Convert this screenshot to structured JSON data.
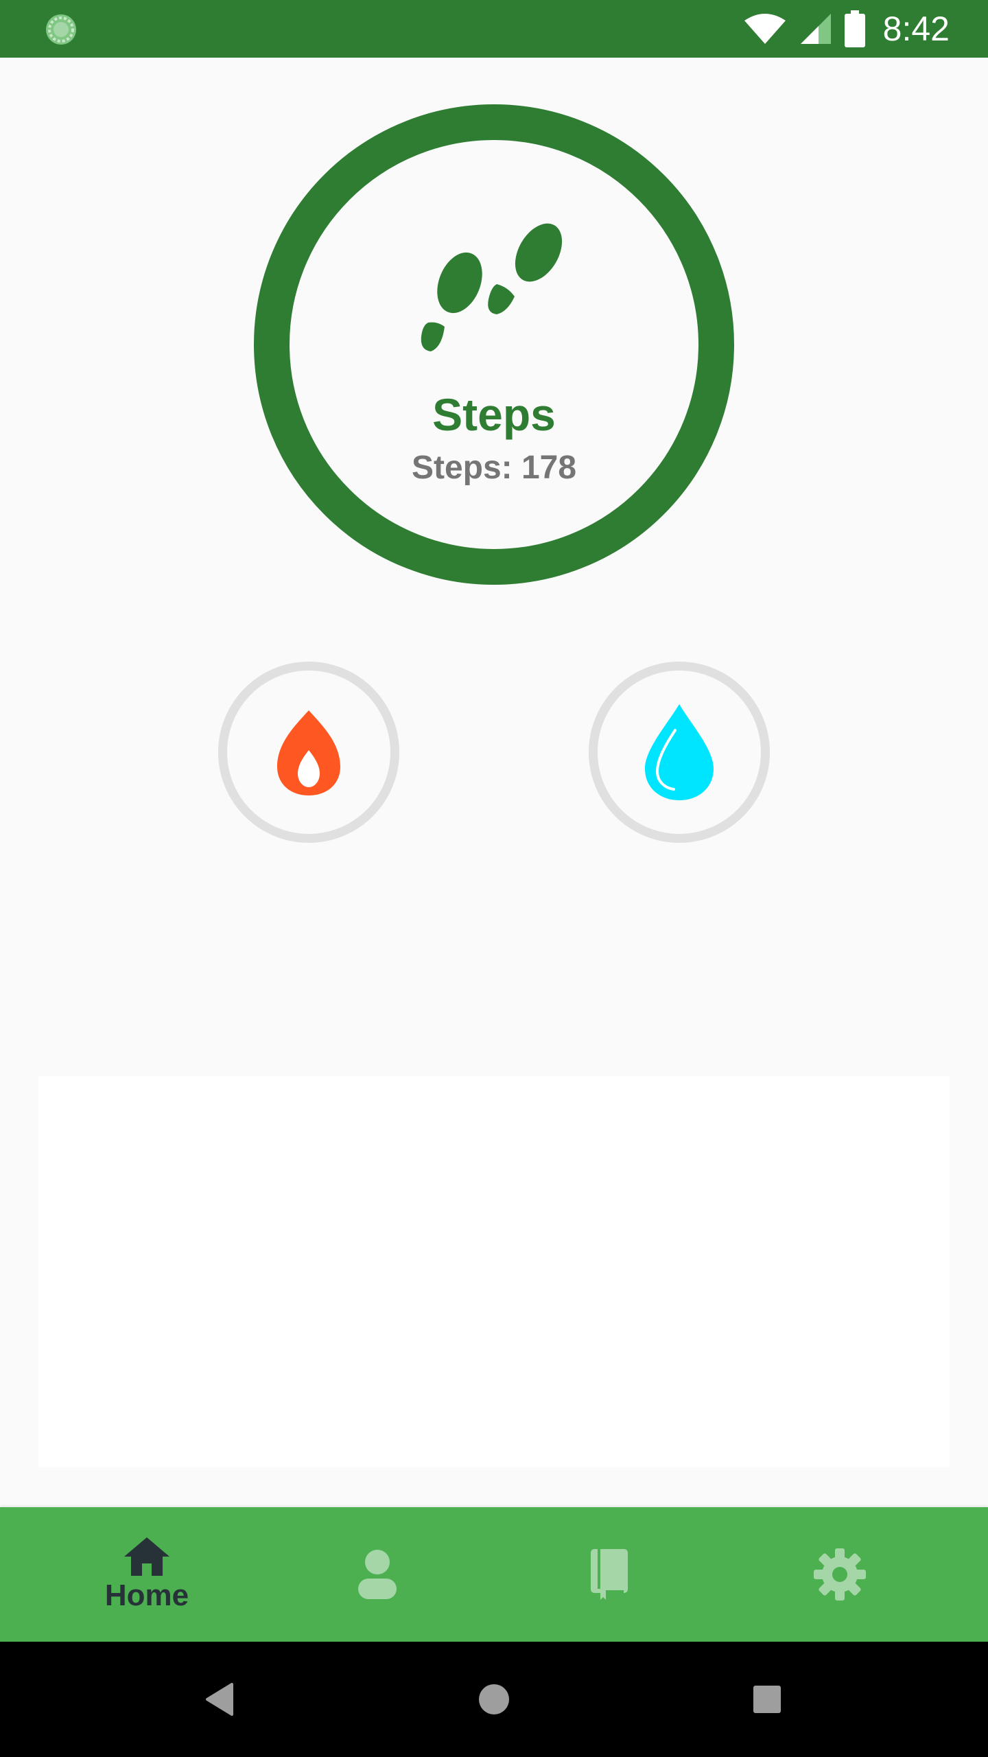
{
  "status_bar": {
    "time": "8:42",
    "left_icon": "sync-progress-icon",
    "right_icons": [
      "wifi-icon",
      "cellular-signal-icon",
      "battery-icon"
    ]
  },
  "steps_card": {
    "icon": "footprints-icon",
    "title": "Steps",
    "count_text": "Steps: 178",
    "ring_color": "#2e7d32"
  },
  "metrics": [
    {
      "name": "calories",
      "icon": "flame-icon",
      "color": "#ff5722"
    },
    {
      "name": "water",
      "icon": "water-drop-icon",
      "color": "#00e5ff"
    }
  ],
  "bottom_nav": {
    "items": [
      {
        "label": "Home",
        "icon": "home-icon",
        "active": true
      },
      {
        "label": "",
        "icon": "person-icon",
        "active": false
      },
      {
        "label": "",
        "icon": "book-icon",
        "active": false
      },
      {
        "label": "",
        "icon": "gear-icon",
        "active": false
      }
    ]
  },
  "system_nav": [
    "back-icon",
    "home-circle-icon",
    "recents-icon"
  ],
  "colors": {
    "primary_dark": "#2e7d32",
    "primary": "#4caf50",
    "inactive_nav_icon": "#a5d6a7",
    "active_nav": "#263238"
  }
}
